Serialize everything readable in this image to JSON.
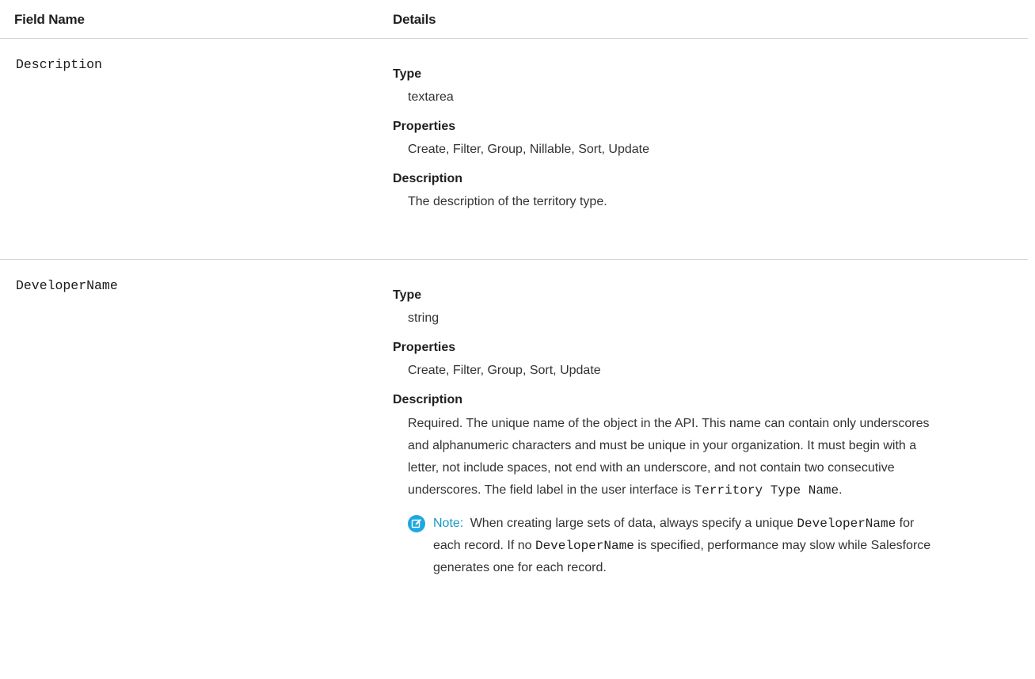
{
  "header": {
    "field_name": "Field Name",
    "details": "Details"
  },
  "rows": [
    {
      "field_name": "Description",
      "type_label": "Type",
      "type_value": "textarea",
      "properties_label": "Properties",
      "properties_value": "Create, Filter, Group, Nillable, Sort, Update",
      "description_label": "Description",
      "description_value": "The description of the territory type."
    },
    {
      "field_name": "DeveloperName",
      "type_label": "Type",
      "type_value": "string",
      "properties_label": "Properties",
      "properties_value": "Create, Filter, Group, Sort, Update",
      "description_label": "Description",
      "description_value": "Required. The unique name of the object in the API. This name can contain only underscores and alphanumeric characters and must be unique in your organization. It must begin with a letter, not include spaces, not end with an underscore, and not contain two consecutive underscores. The field label in the user interface is",
      "description_code": "Territory Type Name",
      "description_end": ".",
      "note": {
        "icon": "edit-note-icon",
        "label": "Note:",
        "text_1": "When creating large sets of data, always specify a unique",
        "code_1": "DeveloperName",
        "text_2": "for each record. If no",
        "code_2": "DeveloperName",
        "text_3": "is specified, performance may slow while Salesforce generates one for each record."
      }
    }
  ],
  "colors": {
    "note_accent": "#1798c8",
    "divider": "#d6d6d6"
  }
}
